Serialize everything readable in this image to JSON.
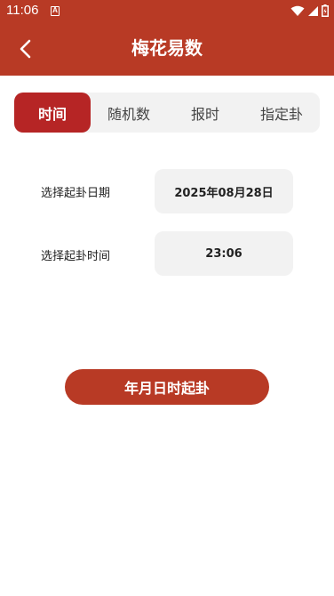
{
  "status_bar": {
    "time": "11:06",
    "notification_icon": "a-icon",
    "icons": [
      "wifi-icon",
      "signal-icon",
      "battery-icon"
    ]
  },
  "header": {
    "title": "梅花易数",
    "back_icon": "chevron-left-icon"
  },
  "tabs": [
    {
      "label": "时间",
      "active": true
    },
    {
      "label": "随机数",
      "active": false
    },
    {
      "label": "报时",
      "active": false
    },
    {
      "label": "指定卦",
      "active": false
    }
  ],
  "form": {
    "date_label": "选择起卦日期",
    "date_value": "2025年08月28日",
    "time_label": "选择起卦时间",
    "time_value": "23:06"
  },
  "submit_label": "年月日时起卦",
  "colors": {
    "header": "#b83a25",
    "active_tab": "#b62525",
    "button": "#b83a25",
    "field_bg": "#f2f2f2"
  }
}
